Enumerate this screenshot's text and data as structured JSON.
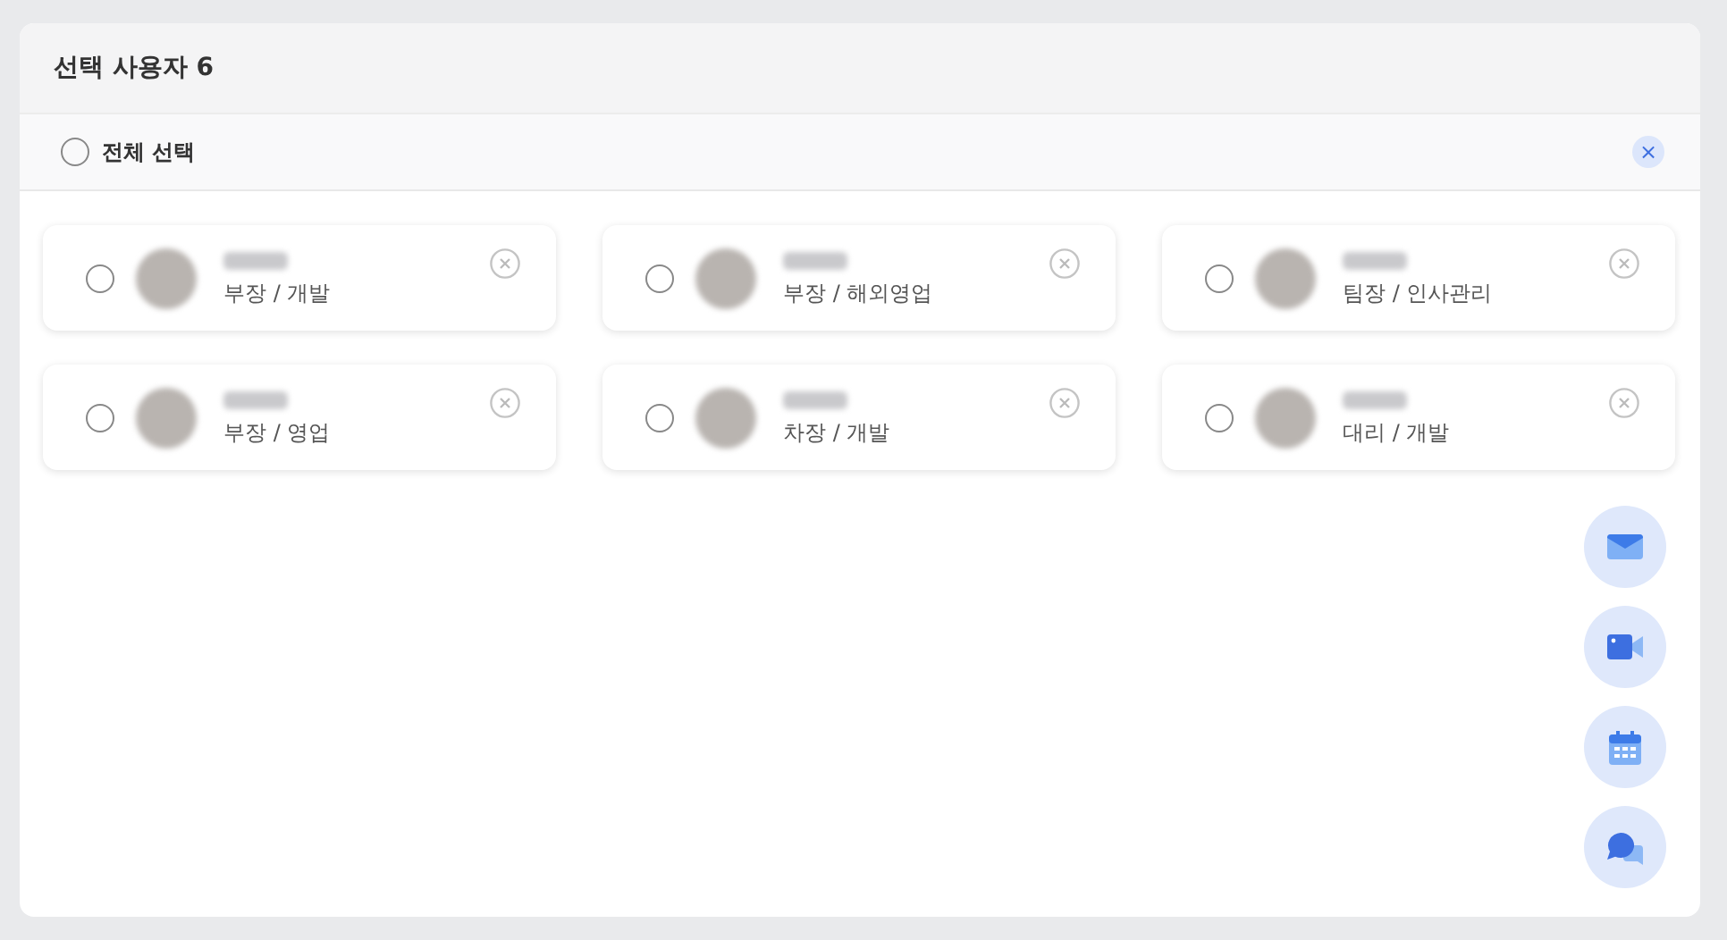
{
  "header": {
    "title": "선택 사용자 6"
  },
  "select_all": {
    "label": "전체 선택",
    "checked": false,
    "clear_button": "×"
  },
  "users": [
    {
      "role": "부장 / 개발",
      "selected": false
    },
    {
      "role": "부장 / 해외영업",
      "selected": false
    },
    {
      "role": "팀장 / 인사관리",
      "selected": false
    },
    {
      "role": "부장 / 영업",
      "selected": false
    },
    {
      "role": "차장 / 개발",
      "selected": false
    },
    {
      "role": "대리 / 개발",
      "selected": false
    }
  ],
  "actions": [
    {
      "kind": "mail"
    },
    {
      "kind": "video"
    },
    {
      "kind": "calendar"
    },
    {
      "kind": "chat"
    }
  ]
}
